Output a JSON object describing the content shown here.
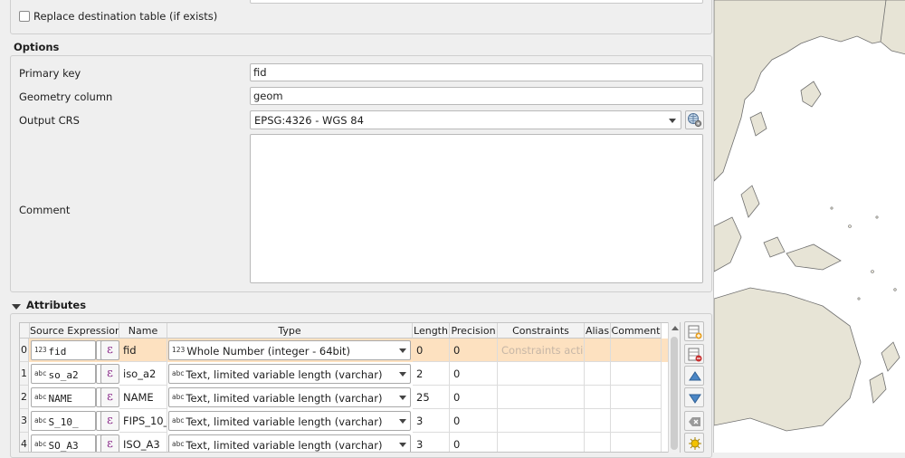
{
  "destination": {
    "replace_label": "Replace destination table (if exists)"
  },
  "options": {
    "title": "Options",
    "primary_key_label": "Primary key",
    "primary_key_value": "fid",
    "geometry_label": "Geometry column",
    "geometry_value": "geom",
    "crs_label": "Output CRS",
    "crs_value": "EPSG:4326 - WGS 84",
    "comment_label": "Comment",
    "comment_value": ""
  },
  "attributes": {
    "title": "Attributes",
    "headers": {
      "source": "Source Expression",
      "name": "Name",
      "type": "Type",
      "length": "Length",
      "precision": "Precision",
      "constraints": "Constraints",
      "alias": "Alias",
      "comment": "Comment"
    },
    "rows": [
      {
        "index": "0",
        "src_tag": "123",
        "source": "fid",
        "name": "fid",
        "type_tag": "123",
        "type": "Whole Number (integer - 64bit)",
        "length": "0",
        "precision": "0",
        "constraints": "Constraints active"
      },
      {
        "index": "1",
        "src_tag": "abc",
        "source": "so_a2",
        "name": "iso_a2",
        "type_tag": "abc",
        "type": "Text, limited variable length (varchar)",
        "length": "2",
        "precision": "0",
        "constraints": ""
      },
      {
        "index": "2",
        "src_tag": "abc",
        "source": "NAME",
        "name": "NAME",
        "type_tag": "abc",
        "type": "Text, limited variable length (varchar)",
        "length": "25",
        "precision": "0",
        "constraints": ""
      },
      {
        "index": "3",
        "src_tag": "abc",
        "source": "S_10_",
        "name": "FIPS_10_",
        "type_tag": "abc",
        "type": "Text, limited variable length (varchar)",
        "length": "3",
        "precision": "0",
        "constraints": ""
      },
      {
        "index": "4",
        "src_tag": "abc",
        "source": "SO_A3",
        "name": "ISO_A3",
        "type_tag": "abc",
        "type": "Text, limited variable length (varchar)",
        "length": "3",
        "precision": "0",
        "constraints": ""
      }
    ]
  },
  "colors": {
    "selected_row": "#fde1c0",
    "land": "#e7e4d6",
    "expression_icon": "#8a2a8a"
  }
}
